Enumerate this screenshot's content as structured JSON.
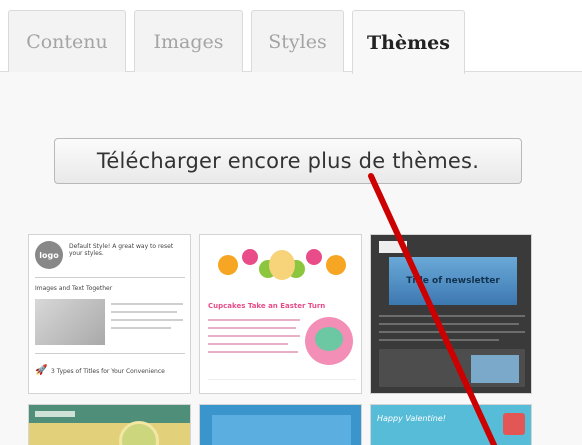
{
  "tabs": [
    {
      "label": "Contenu",
      "active": false
    },
    {
      "label": "Images",
      "active": false
    },
    {
      "label": "Styles",
      "active": false
    },
    {
      "label": "Thèmes",
      "active": true
    }
  ],
  "download_button": {
    "label": "Télécharger encore plus de thèmes."
  },
  "themes": {
    "default": {
      "logo": "logo",
      "title": "Default Style! A great way to reset your styles.",
      "section": "Images and Text Together",
      "footer": "3 Types of Titles for Your Convenience"
    },
    "easter": {
      "title": "Cupcakes Take an Easter Turn"
    },
    "newsletter": {
      "title": "Title of newsletter"
    },
    "valentine": {
      "title": "Happy Valentine!"
    }
  },
  "colors": {
    "accent_pointer": "#cc0000",
    "newsletter_dark": "#3a3a3a",
    "easter_pink": "#e84d8a"
  }
}
